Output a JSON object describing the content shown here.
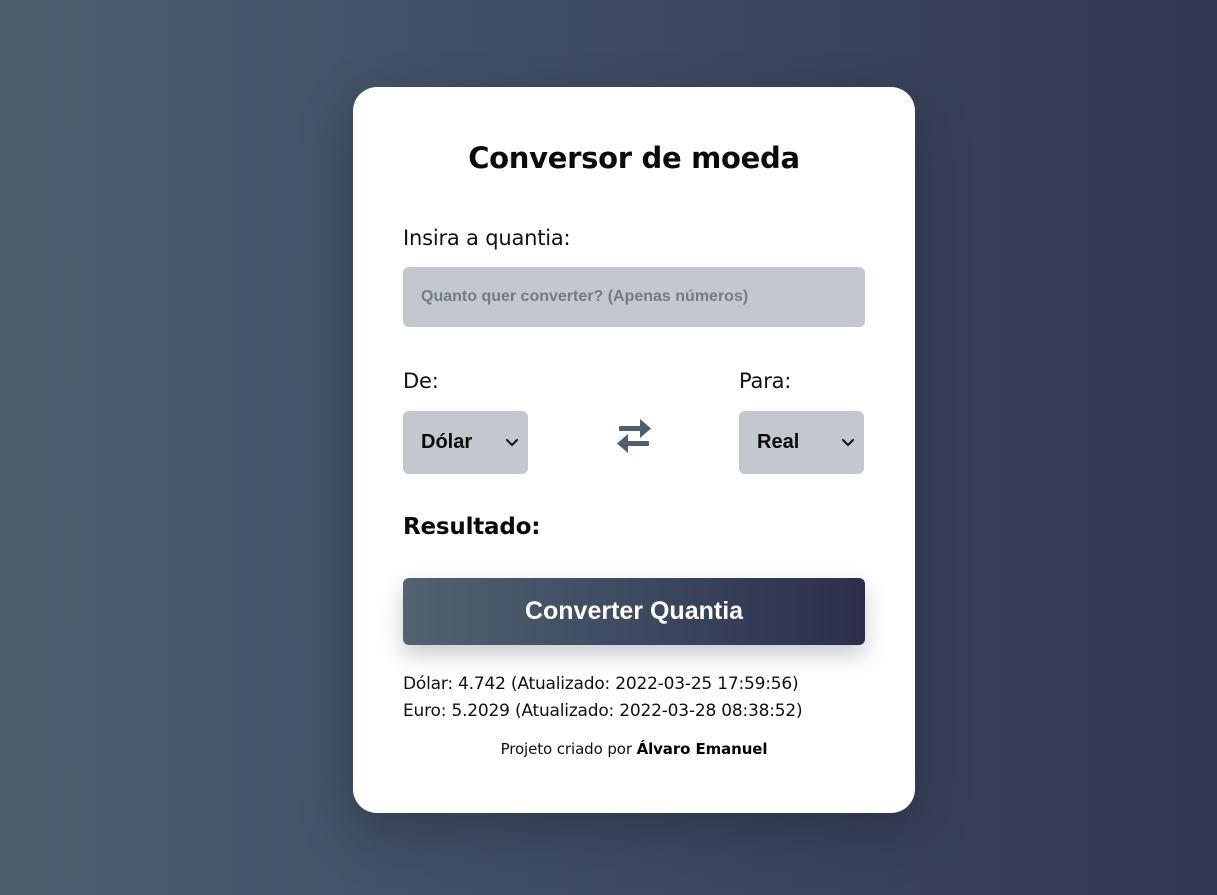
{
  "card": {
    "title": "Conversor de moeda",
    "amount_label": "Insira a quantia:",
    "amount_input": {
      "value": "",
      "placeholder": "Quanto quer converter? (Apenas números)"
    },
    "from_label": "De:",
    "from_select": {
      "selected": "Dólar"
    },
    "to_label": "Para:",
    "to_select": {
      "selected": "Real"
    },
    "swap_icon": "swap-arrows-icon",
    "result_label": "Resultado:",
    "convert_button": "Converter Quantia",
    "rates": {
      "dolar": "Dólar: 4.742 (Atualizado: 2022-03-25 17:59:56)",
      "euro": "Euro: 5.2029 (Atualizado: 2022-03-28 08:38:52)"
    },
    "footer": {
      "prefix": "Projeto criado por",
      "author": "Álvaro Emanuel"
    }
  },
  "colors": {
    "background_start": "#4e5e6f",
    "background_end": "#323850",
    "input_bg": "#c2c8ce",
    "icon": "#4c6070",
    "button_start": "#526271",
    "button_end": "#2c2f4a"
  }
}
